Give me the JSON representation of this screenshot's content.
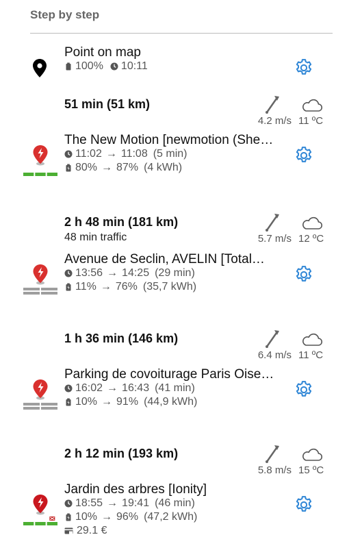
{
  "header": {
    "title": "Step by step"
  },
  "start": {
    "title": "Point on map",
    "battery": "100%",
    "time": "10:11"
  },
  "legs": [
    {
      "duration": "51 min (51 km)",
      "traffic": "",
      "wind": "4.2 m/s",
      "temp": "11 ºC"
    },
    {
      "duration": "2 h 48 min (181 km)",
      "traffic": "48 min traffic",
      "wind": "5.7 m/s",
      "temp": "12 ºC"
    },
    {
      "duration": "1 h 36 min (146 km)",
      "traffic": "",
      "wind": "6.4 m/s",
      "temp": "11 ºC"
    },
    {
      "duration": "2 h 12 min (193 km)",
      "traffic": "",
      "wind": "5.8 m/s",
      "temp": "15 ºC"
    }
  ],
  "stops": [
    {
      "title": "The New Motion [newmotion (She…",
      "arrive": "11:02",
      "depart": "11:08",
      "wait": "(5 min)",
      "soc_from": "80%",
      "soc_to": "87%",
      "energy": "(4 kWh)",
      "connectors": [
        "available",
        "available",
        "available"
      ],
      "pin_color": "#d9302e"
    },
    {
      "title": "Avenue de Seclin, AVELIN [Total…",
      "arrive": "13:56",
      "depart": "14:25",
      "wait": "(29 min)",
      "soc_from": "11%",
      "soc_to": "76%",
      "energy": "(35,7 kWh)",
      "connectors": [
        "unknown",
        "unknown"
      ],
      "pin_color": "#d9302e"
    },
    {
      "title": "Parking de covoiturage Paris Oise…",
      "arrive": "16:02",
      "depart": "16:43",
      "wait": "(41 min)",
      "soc_from": "10%",
      "soc_to": "91%",
      "energy": "(44,9 kWh)",
      "connectors": [
        "unknown",
        "unknown"
      ],
      "pin_color": "#d9302e"
    },
    {
      "title": "Jardin des arbres [Ionity]",
      "arrive": "18:55",
      "depart": "19:41",
      "wait": "(46 min)",
      "soc_from": "10%",
      "soc_to": "96%",
      "energy": "(47,2 kWh)",
      "cost": "29.1 €",
      "connectors": [
        "available",
        "available",
        "faulty"
      ],
      "pin_color": "#c9171e"
    }
  ],
  "colors": {
    "accent": "#2f86d6",
    "available": "#4caf33",
    "unknown": "#9e9e9e",
    "faulty": "#c62828"
  }
}
